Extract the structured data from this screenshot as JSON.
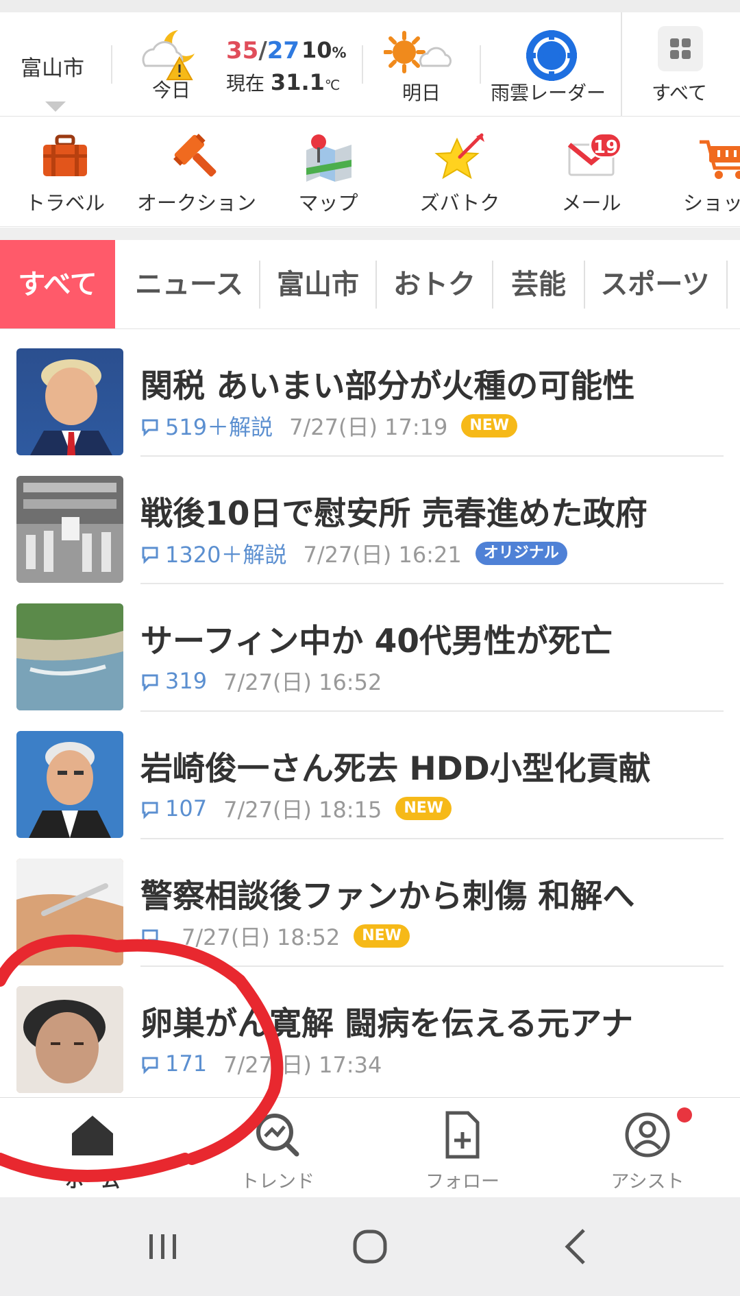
{
  "weather": {
    "city": "富山市",
    "today": {
      "label": "今日",
      "high": "35",
      "slash": "/",
      "low": "27",
      "rain_value": "10",
      "rain_unit": "%",
      "current_prefix": "現在",
      "current_value": "31.1",
      "current_unit": "℃"
    },
    "tomorrow_label": "明日",
    "radar_label": "雨雲レーダー",
    "all_label": "すべて",
    "colors": {
      "high": "#e04d5a",
      "low": "#2f7ae0"
    }
  },
  "services": [
    {
      "label": "トラベル",
      "icon": "suitcase-icon"
    },
    {
      "label": "オークション",
      "icon": "gavel-icon"
    },
    {
      "label": "マップ",
      "icon": "map-pin-icon"
    },
    {
      "label": "ズバトク",
      "icon": "star-arrow-icon"
    },
    {
      "label": "メール",
      "icon": "mail-icon",
      "badge": "19"
    },
    {
      "label": "ショッピ",
      "icon": "cart-icon"
    }
  ],
  "tabs": [
    {
      "label": "すべて",
      "active": true
    },
    {
      "label": "ニュース"
    },
    {
      "label": "富山市"
    },
    {
      "label": "おトク"
    },
    {
      "label": "芸能"
    },
    {
      "label": "スポーツ"
    }
  ],
  "news": [
    {
      "headline": "関税 あいまい部分が火種の可能性",
      "comments": "519＋解説",
      "time": "7/27(日) 17:19",
      "tag": "NEW",
      "tag_type": "new"
    },
    {
      "headline": "戦後10日で慰安所 売春進めた政府",
      "comments": "1320＋解説",
      "time": "7/27(日) 16:21",
      "tag": "オリジナル",
      "tag_type": "original"
    },
    {
      "headline": "サーフィン中か 40代男性が死亡",
      "comments": "319",
      "time": "7/27(日) 16:52",
      "tag": "",
      "tag_type": ""
    },
    {
      "headline": "岩崎俊一さん死去 HDD小型化貢献",
      "comments": "107",
      "time": "7/27(日) 18:15",
      "tag": "NEW",
      "tag_type": "new"
    },
    {
      "headline": "警察相談後ファンから刺傷 和解へ",
      "comments": "",
      "time": "7/27(日) 18:52",
      "tag": "NEW",
      "tag_type": "new"
    },
    {
      "headline": "卵巣がん寛解 闘病を伝える元アナ",
      "comments": "171",
      "time": "7/27(日) 17:34",
      "tag": "",
      "tag_type": ""
    }
  ],
  "bottom_nav": [
    {
      "label": "ホーム",
      "icon": "home-icon",
      "active": true
    },
    {
      "label": "トレンド",
      "icon": "trend-icon"
    },
    {
      "label": "フォロー",
      "icon": "follow-icon"
    },
    {
      "label": "アシスト",
      "icon": "assist-icon",
      "dot": true
    }
  ],
  "system_nav": [
    "recent-apps-icon",
    "home-circle-icon",
    "back-icon"
  ]
}
